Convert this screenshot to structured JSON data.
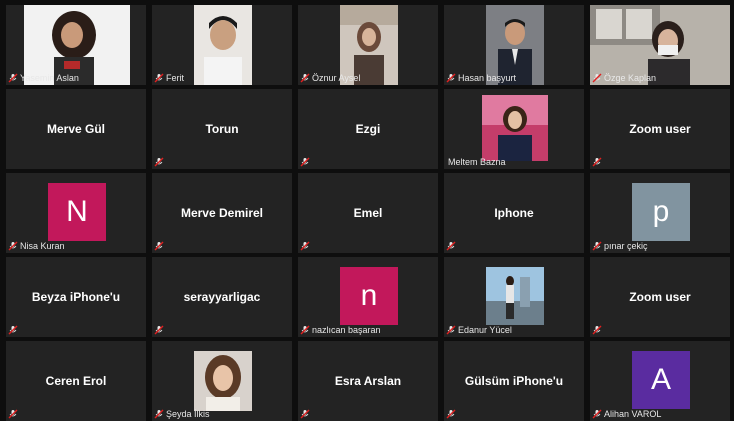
{
  "colors": {
    "tile_bg": "#232323",
    "screen_bg": "#0e0e0e",
    "muted_mic": "#e02020",
    "avatar_n": "#c2185b",
    "avatar_p": "#8194a0",
    "avatar_n2": "#c2185b",
    "avatar_a": "#5a2ca0"
  },
  "participants": [
    {
      "name": "Yasemin Aslan",
      "kind": "video",
      "muted": true
    },
    {
      "name": "Ferit",
      "kind": "video",
      "muted": true
    },
    {
      "name": "Öznur Aysel",
      "kind": "video",
      "muted": true
    },
    {
      "name": "Hasan başyurt",
      "kind": "video",
      "muted": true
    },
    {
      "name": "Özge Kaplan",
      "kind": "video",
      "muted": true
    },
    {
      "name": "Merve Gül",
      "kind": "name-only",
      "muted": false
    },
    {
      "name": "Torun",
      "kind": "name-only",
      "muted": true
    },
    {
      "name": "Ezgi",
      "kind": "name-only",
      "muted": true
    },
    {
      "name": "Meltem Bazna",
      "kind": "photo",
      "muted": false
    },
    {
      "name": "Zoom user",
      "kind": "name-only",
      "muted": true
    },
    {
      "name": "Nisa Kuran",
      "kind": "avatar",
      "initial": "N",
      "muted": true
    },
    {
      "name": "Merve Demirel",
      "kind": "name-only",
      "muted": true
    },
    {
      "name": "Emel",
      "kind": "name-only",
      "muted": true
    },
    {
      "name": "Iphone",
      "kind": "name-only",
      "muted": true
    },
    {
      "name": "pınar çekiç",
      "kind": "avatar",
      "initial": "p",
      "muted": true
    },
    {
      "name": "Beyza iPhone'u",
      "kind": "name-only",
      "muted": true
    },
    {
      "name": "serayyarligac",
      "kind": "name-only",
      "muted": true
    },
    {
      "name": "nazlıcan başaran",
      "kind": "avatar",
      "initial": "n",
      "muted": true
    },
    {
      "name": "Edanur Yücel",
      "kind": "photo",
      "muted": true
    },
    {
      "name": "Zoom user",
      "kind": "name-only",
      "muted": true
    },
    {
      "name": "Ceren Erol",
      "kind": "name-only",
      "muted": true
    },
    {
      "name": "Şeyda İlkis",
      "kind": "photo",
      "muted": true
    },
    {
      "name": "Esra Arslan",
      "kind": "name-only",
      "muted": true
    },
    {
      "name": "Gülsüm iPhone'u",
      "kind": "name-only",
      "muted": true
    },
    {
      "name": "Alihan VAROL",
      "kind": "avatar",
      "initial": "A",
      "muted": true
    }
  ]
}
